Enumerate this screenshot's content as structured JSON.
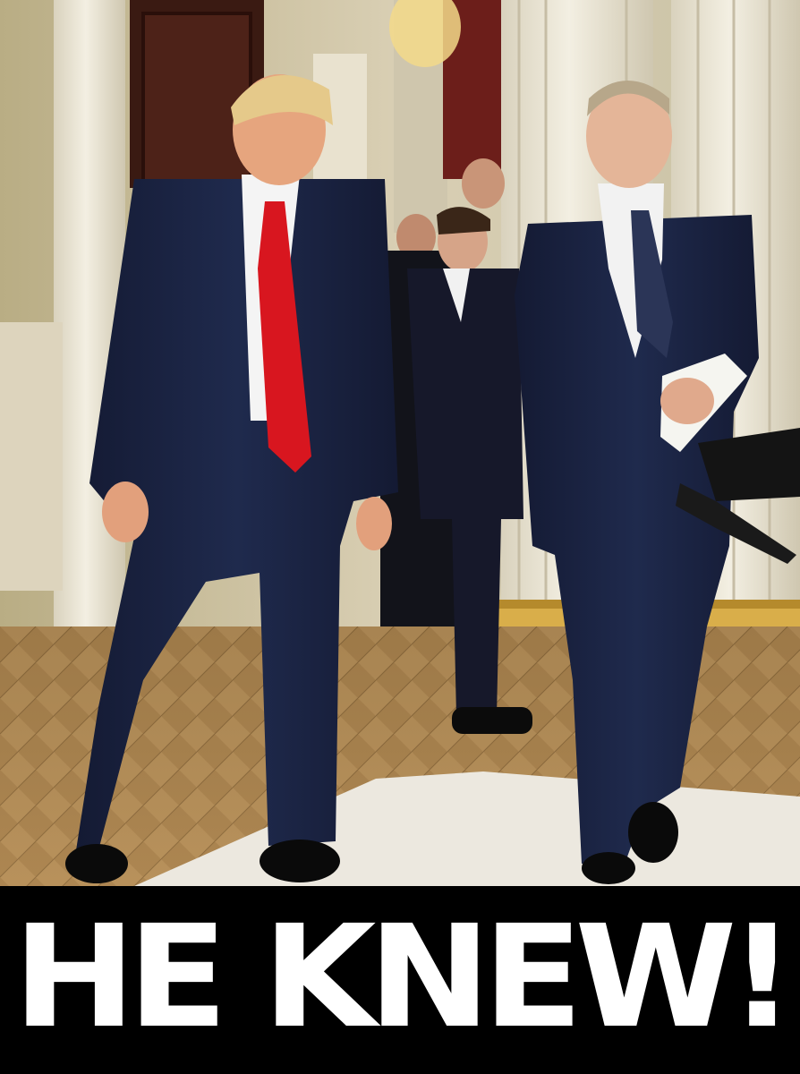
{
  "caption": {
    "text": "HE KNEW!"
  }
}
